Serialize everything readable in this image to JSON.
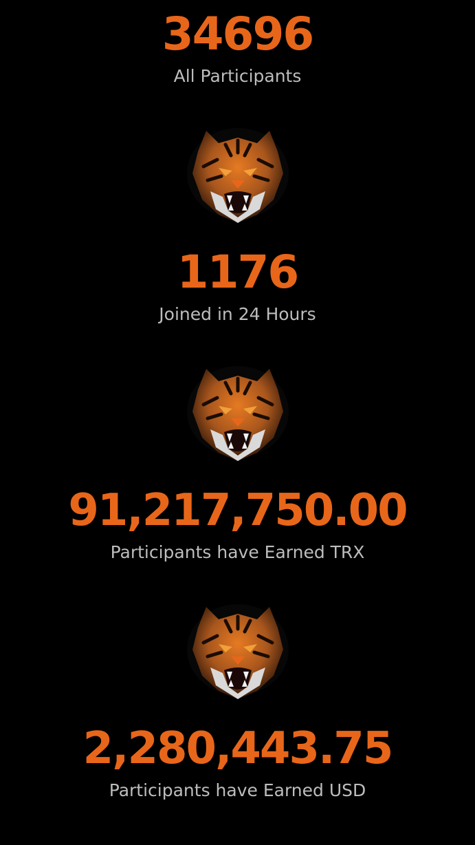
{
  "colors": {
    "background": "#000000",
    "accent": "#e8661a",
    "label": "#bdbdbd"
  },
  "stats": [
    {
      "value": "34696",
      "label": "All Participants"
    },
    {
      "value": "1176",
      "label": "Joined in 24 Hours"
    },
    {
      "value": "91,217,750.00",
      "label": "Participants have Earned TRX"
    },
    {
      "value": "2,280,443.75",
      "label": "Participants have Earned USD"
    }
  ],
  "icons": [
    "tiger-icon",
    "tiger-icon",
    "tiger-icon"
  ]
}
